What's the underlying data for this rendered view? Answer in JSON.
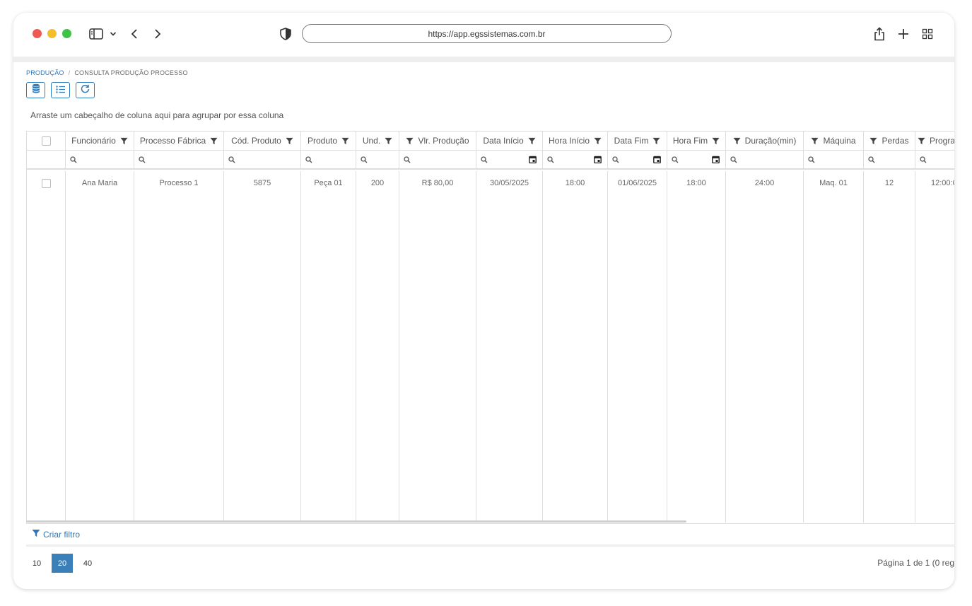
{
  "browser": {
    "url": "https://app.egssistemas.com.br"
  },
  "breadcrumb": {
    "parent": "PRODUÇÃO",
    "separator": "/",
    "current": "CONSULTA PRODUÇÃO PROCESSO"
  },
  "grid": {
    "group_hint": "Arraste um cabeçalho de coluna aqui para agrupar por essa coluna",
    "columns": [
      {
        "label": "Funcionário",
        "filter_side": "right",
        "date": false
      },
      {
        "label": "Processo Fábrica",
        "filter_side": "right",
        "date": false
      },
      {
        "label": "Cód. Produto",
        "filter_side": "right",
        "date": false
      },
      {
        "label": "Produto",
        "filter_side": "right",
        "date": false
      },
      {
        "label": "Und.",
        "filter_side": "right",
        "date": false
      },
      {
        "label": "Vlr. Produção",
        "filter_side": "left",
        "date": false
      },
      {
        "label": "Data Início",
        "filter_side": "right",
        "date": true
      },
      {
        "label": "Hora Início",
        "filter_side": "right",
        "date": true
      },
      {
        "label": "Data Fim",
        "filter_side": "right",
        "date": true
      },
      {
        "label": "Hora Fim",
        "filter_side": "right",
        "date": true
      },
      {
        "label": "Duração(min)",
        "filter_side": "left",
        "date": false
      },
      {
        "label": "Máquina",
        "filter_side": "left",
        "date": false
      },
      {
        "label": "Perdas",
        "filter_side": "left",
        "date": false
      },
      {
        "label": "Progra",
        "filter_side": "left",
        "date": false
      }
    ],
    "rows": [
      [
        "Ana Maria",
        "Processo 1",
        "5875",
        "Peça 01",
        "200",
        "R$ 80,00",
        "30/05/2025",
        "18:00",
        "01/06/2025",
        "18:00",
        "24:00",
        "Maq. 01",
        "12",
        "12:00:0"
      ]
    ]
  },
  "filter_bar": {
    "label": "Criar filtro"
  },
  "pager": {
    "sizes": [
      "10",
      "20",
      "40"
    ],
    "active": "20",
    "info": "Página 1 de 1 (0 reg"
  },
  "colors": {
    "accent": "#2e77b8",
    "active_page": "#3a7fb8"
  }
}
